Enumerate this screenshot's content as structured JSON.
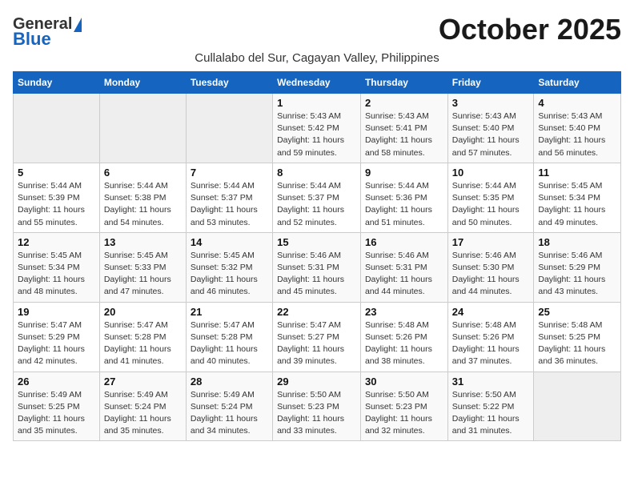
{
  "header": {
    "logo_general": "General",
    "logo_blue": "Blue",
    "month_title": "October 2025",
    "subtitle": "Cullalabo del Sur, Cagayan Valley, Philippines"
  },
  "days_of_week": [
    "Sunday",
    "Monday",
    "Tuesday",
    "Wednesday",
    "Thursday",
    "Friday",
    "Saturday"
  ],
  "weeks": [
    [
      {
        "day": "",
        "empty": true
      },
      {
        "day": "",
        "empty": true
      },
      {
        "day": "",
        "empty": true
      },
      {
        "day": "1",
        "sunrise": "Sunrise: 5:43 AM",
        "sunset": "Sunset: 5:42 PM",
        "daylight": "Daylight: 11 hours and 59 minutes."
      },
      {
        "day": "2",
        "sunrise": "Sunrise: 5:43 AM",
        "sunset": "Sunset: 5:41 PM",
        "daylight": "Daylight: 11 hours and 58 minutes."
      },
      {
        "day": "3",
        "sunrise": "Sunrise: 5:43 AM",
        "sunset": "Sunset: 5:40 PM",
        "daylight": "Daylight: 11 hours and 57 minutes."
      },
      {
        "day": "4",
        "sunrise": "Sunrise: 5:43 AM",
        "sunset": "Sunset: 5:40 PM",
        "daylight": "Daylight: 11 hours and 56 minutes."
      }
    ],
    [
      {
        "day": "5",
        "sunrise": "Sunrise: 5:44 AM",
        "sunset": "Sunset: 5:39 PM",
        "daylight": "Daylight: 11 hours and 55 minutes."
      },
      {
        "day": "6",
        "sunrise": "Sunrise: 5:44 AM",
        "sunset": "Sunset: 5:38 PM",
        "daylight": "Daylight: 11 hours and 54 minutes."
      },
      {
        "day": "7",
        "sunrise": "Sunrise: 5:44 AM",
        "sunset": "Sunset: 5:37 PM",
        "daylight": "Daylight: 11 hours and 53 minutes."
      },
      {
        "day": "8",
        "sunrise": "Sunrise: 5:44 AM",
        "sunset": "Sunset: 5:37 PM",
        "daylight": "Daylight: 11 hours and 52 minutes."
      },
      {
        "day": "9",
        "sunrise": "Sunrise: 5:44 AM",
        "sunset": "Sunset: 5:36 PM",
        "daylight": "Daylight: 11 hours and 51 minutes."
      },
      {
        "day": "10",
        "sunrise": "Sunrise: 5:44 AM",
        "sunset": "Sunset: 5:35 PM",
        "daylight": "Daylight: 11 hours and 50 minutes."
      },
      {
        "day": "11",
        "sunrise": "Sunrise: 5:45 AM",
        "sunset": "Sunset: 5:34 PM",
        "daylight": "Daylight: 11 hours and 49 minutes."
      }
    ],
    [
      {
        "day": "12",
        "sunrise": "Sunrise: 5:45 AM",
        "sunset": "Sunset: 5:34 PM",
        "daylight": "Daylight: 11 hours and 48 minutes."
      },
      {
        "day": "13",
        "sunrise": "Sunrise: 5:45 AM",
        "sunset": "Sunset: 5:33 PM",
        "daylight": "Daylight: 11 hours and 47 minutes."
      },
      {
        "day": "14",
        "sunrise": "Sunrise: 5:45 AM",
        "sunset": "Sunset: 5:32 PM",
        "daylight": "Daylight: 11 hours and 46 minutes."
      },
      {
        "day": "15",
        "sunrise": "Sunrise: 5:46 AM",
        "sunset": "Sunset: 5:31 PM",
        "daylight": "Daylight: 11 hours and 45 minutes."
      },
      {
        "day": "16",
        "sunrise": "Sunrise: 5:46 AM",
        "sunset": "Sunset: 5:31 PM",
        "daylight": "Daylight: 11 hours and 44 minutes."
      },
      {
        "day": "17",
        "sunrise": "Sunrise: 5:46 AM",
        "sunset": "Sunset: 5:30 PM",
        "daylight": "Daylight: 11 hours and 44 minutes."
      },
      {
        "day": "18",
        "sunrise": "Sunrise: 5:46 AM",
        "sunset": "Sunset: 5:29 PM",
        "daylight": "Daylight: 11 hours and 43 minutes."
      }
    ],
    [
      {
        "day": "19",
        "sunrise": "Sunrise: 5:47 AM",
        "sunset": "Sunset: 5:29 PM",
        "daylight": "Daylight: 11 hours and 42 minutes."
      },
      {
        "day": "20",
        "sunrise": "Sunrise: 5:47 AM",
        "sunset": "Sunset: 5:28 PM",
        "daylight": "Daylight: 11 hours and 41 minutes."
      },
      {
        "day": "21",
        "sunrise": "Sunrise: 5:47 AM",
        "sunset": "Sunset: 5:28 PM",
        "daylight": "Daylight: 11 hours and 40 minutes."
      },
      {
        "day": "22",
        "sunrise": "Sunrise: 5:47 AM",
        "sunset": "Sunset: 5:27 PM",
        "daylight": "Daylight: 11 hours and 39 minutes."
      },
      {
        "day": "23",
        "sunrise": "Sunrise: 5:48 AM",
        "sunset": "Sunset: 5:26 PM",
        "daylight": "Daylight: 11 hours and 38 minutes."
      },
      {
        "day": "24",
        "sunrise": "Sunrise: 5:48 AM",
        "sunset": "Sunset: 5:26 PM",
        "daylight": "Daylight: 11 hours and 37 minutes."
      },
      {
        "day": "25",
        "sunrise": "Sunrise: 5:48 AM",
        "sunset": "Sunset: 5:25 PM",
        "daylight": "Daylight: 11 hours and 36 minutes."
      }
    ],
    [
      {
        "day": "26",
        "sunrise": "Sunrise: 5:49 AM",
        "sunset": "Sunset: 5:25 PM",
        "daylight": "Daylight: 11 hours and 35 minutes."
      },
      {
        "day": "27",
        "sunrise": "Sunrise: 5:49 AM",
        "sunset": "Sunset: 5:24 PM",
        "daylight": "Daylight: 11 hours and 35 minutes."
      },
      {
        "day": "28",
        "sunrise": "Sunrise: 5:49 AM",
        "sunset": "Sunset: 5:24 PM",
        "daylight": "Daylight: 11 hours and 34 minutes."
      },
      {
        "day": "29",
        "sunrise": "Sunrise: 5:50 AM",
        "sunset": "Sunset: 5:23 PM",
        "daylight": "Daylight: 11 hours and 33 minutes."
      },
      {
        "day": "30",
        "sunrise": "Sunrise: 5:50 AM",
        "sunset": "Sunset: 5:23 PM",
        "daylight": "Daylight: 11 hours and 32 minutes."
      },
      {
        "day": "31",
        "sunrise": "Sunrise: 5:50 AM",
        "sunset": "Sunset: 5:22 PM",
        "daylight": "Daylight: 11 hours and 31 minutes."
      },
      {
        "day": "",
        "empty": true
      }
    ]
  ]
}
